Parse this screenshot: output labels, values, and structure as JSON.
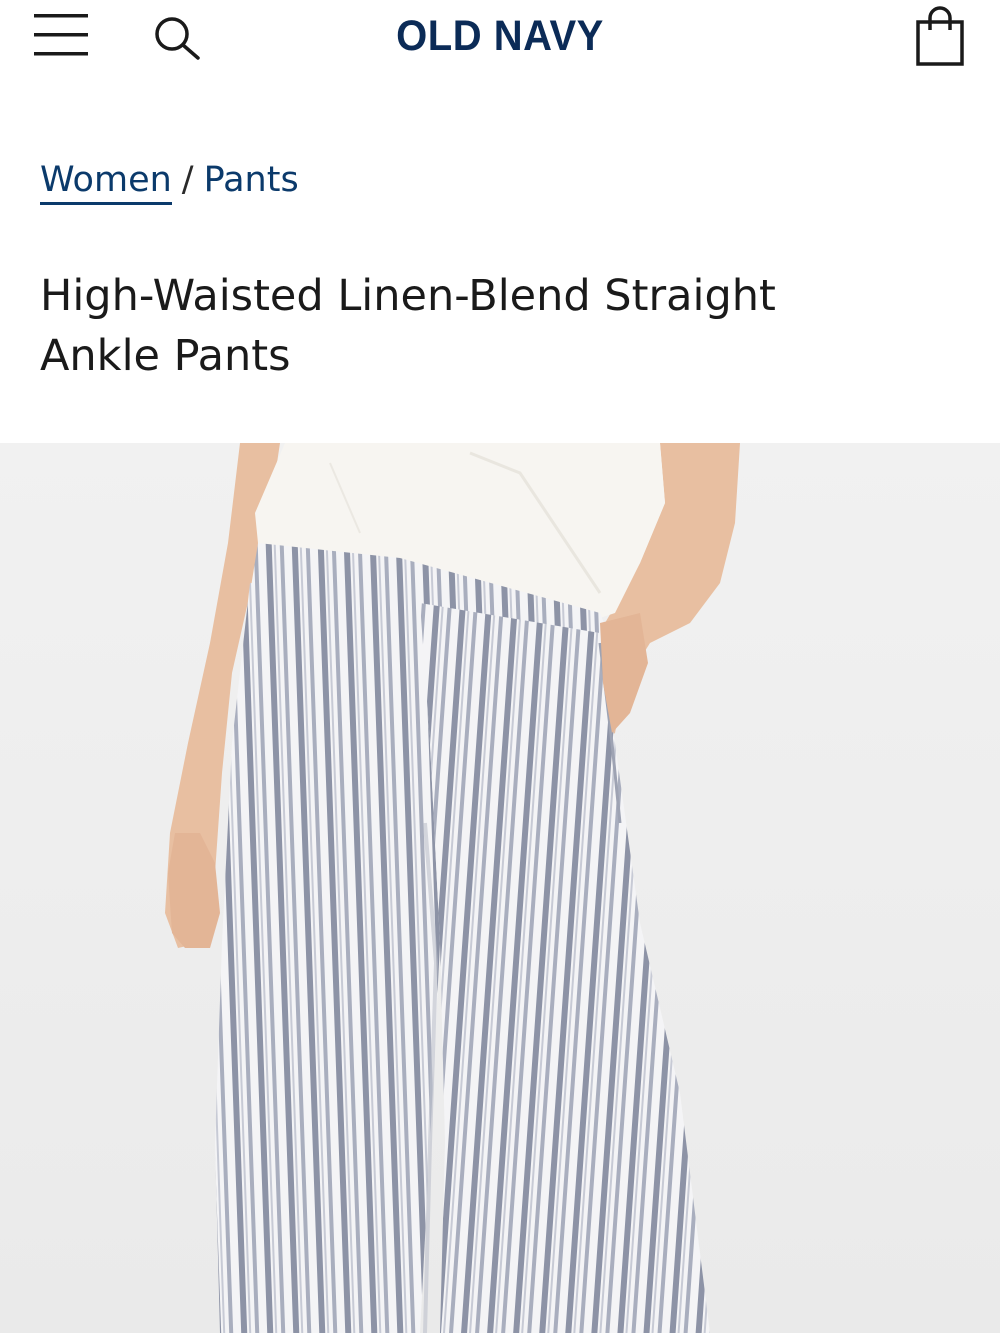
{
  "header": {
    "brand": "OLD NAVY",
    "icons": {
      "menu": "hamburger-menu-icon",
      "search": "search-icon",
      "bag": "shopping-bag-icon"
    },
    "colors": {
      "brand": "#0b2b57",
      "link": "#0b3a6b"
    }
  },
  "breadcrumb": {
    "items": [
      {
        "label": "Women"
      },
      {
        "label": "Pants"
      }
    ],
    "separator": "/"
  },
  "product": {
    "title_line1": "High-Waisted Linen-Blend Straight",
    "title_line2": "Ankle Pants",
    "image": {
      "background": "#eeeeee",
      "top_color": "#f7f5f1",
      "stripe_dark": "#8d93a6",
      "stripe_light": "#f4f4f6",
      "skin": "#e8bfa1"
    }
  }
}
